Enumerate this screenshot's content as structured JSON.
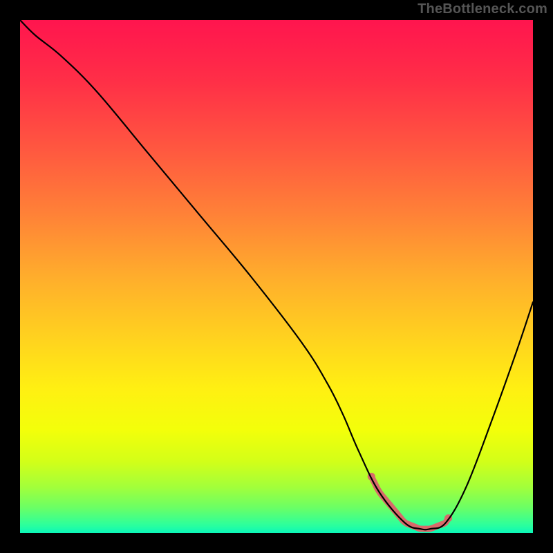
{
  "watermark": "TheBottleneck.com",
  "gradient_stops": [
    {
      "offset": 0.0,
      "color": "#ff154e"
    },
    {
      "offset": 0.12,
      "color": "#ff2f47"
    },
    {
      "offset": 0.25,
      "color": "#ff5740"
    },
    {
      "offset": 0.38,
      "color": "#ff8237"
    },
    {
      "offset": 0.5,
      "color": "#ffad2c"
    },
    {
      "offset": 0.62,
      "color": "#ffd21f"
    },
    {
      "offset": 0.72,
      "color": "#fff012"
    },
    {
      "offset": 0.8,
      "color": "#f3ff0a"
    },
    {
      "offset": 0.86,
      "color": "#d3ff18"
    },
    {
      "offset": 0.91,
      "color": "#a3ff3a"
    },
    {
      "offset": 0.95,
      "color": "#6cff64"
    },
    {
      "offset": 0.985,
      "color": "#2bff9d"
    },
    {
      "offset": 1.0,
      "color": "#0bf7b8"
    }
  ],
  "curve_stroke": "#000000",
  "curve_width": 2.2,
  "highlight_stroke": "#d86a6a",
  "highlight_width": 9,
  "chart_data": {
    "type": "line",
    "title": "",
    "xlabel": "",
    "ylabel": "",
    "xlim": [
      0,
      100
    ],
    "ylim": [
      0,
      100
    ],
    "grid": false,
    "series": [
      {
        "name": "curve",
        "x": [
          0,
          3,
          8,
          15,
          25,
          35,
          45,
          55,
          60,
          63,
          66,
          70,
          75,
          78,
          80,
          83,
          87,
          92,
          97,
          100
        ],
        "y": [
          100,
          97,
          93,
          86,
          74,
          62,
          50,
          37,
          29,
          23,
          16,
          8,
          2,
          0.8,
          0.8,
          2,
          9,
          22,
          36,
          45
        ]
      }
    ],
    "annotations": [
      {
        "name": "valley-highlight",
        "x_range": [
          68.5,
          83.5
        ],
        "note": "thick salmon overlay on valley floor"
      }
    ]
  }
}
